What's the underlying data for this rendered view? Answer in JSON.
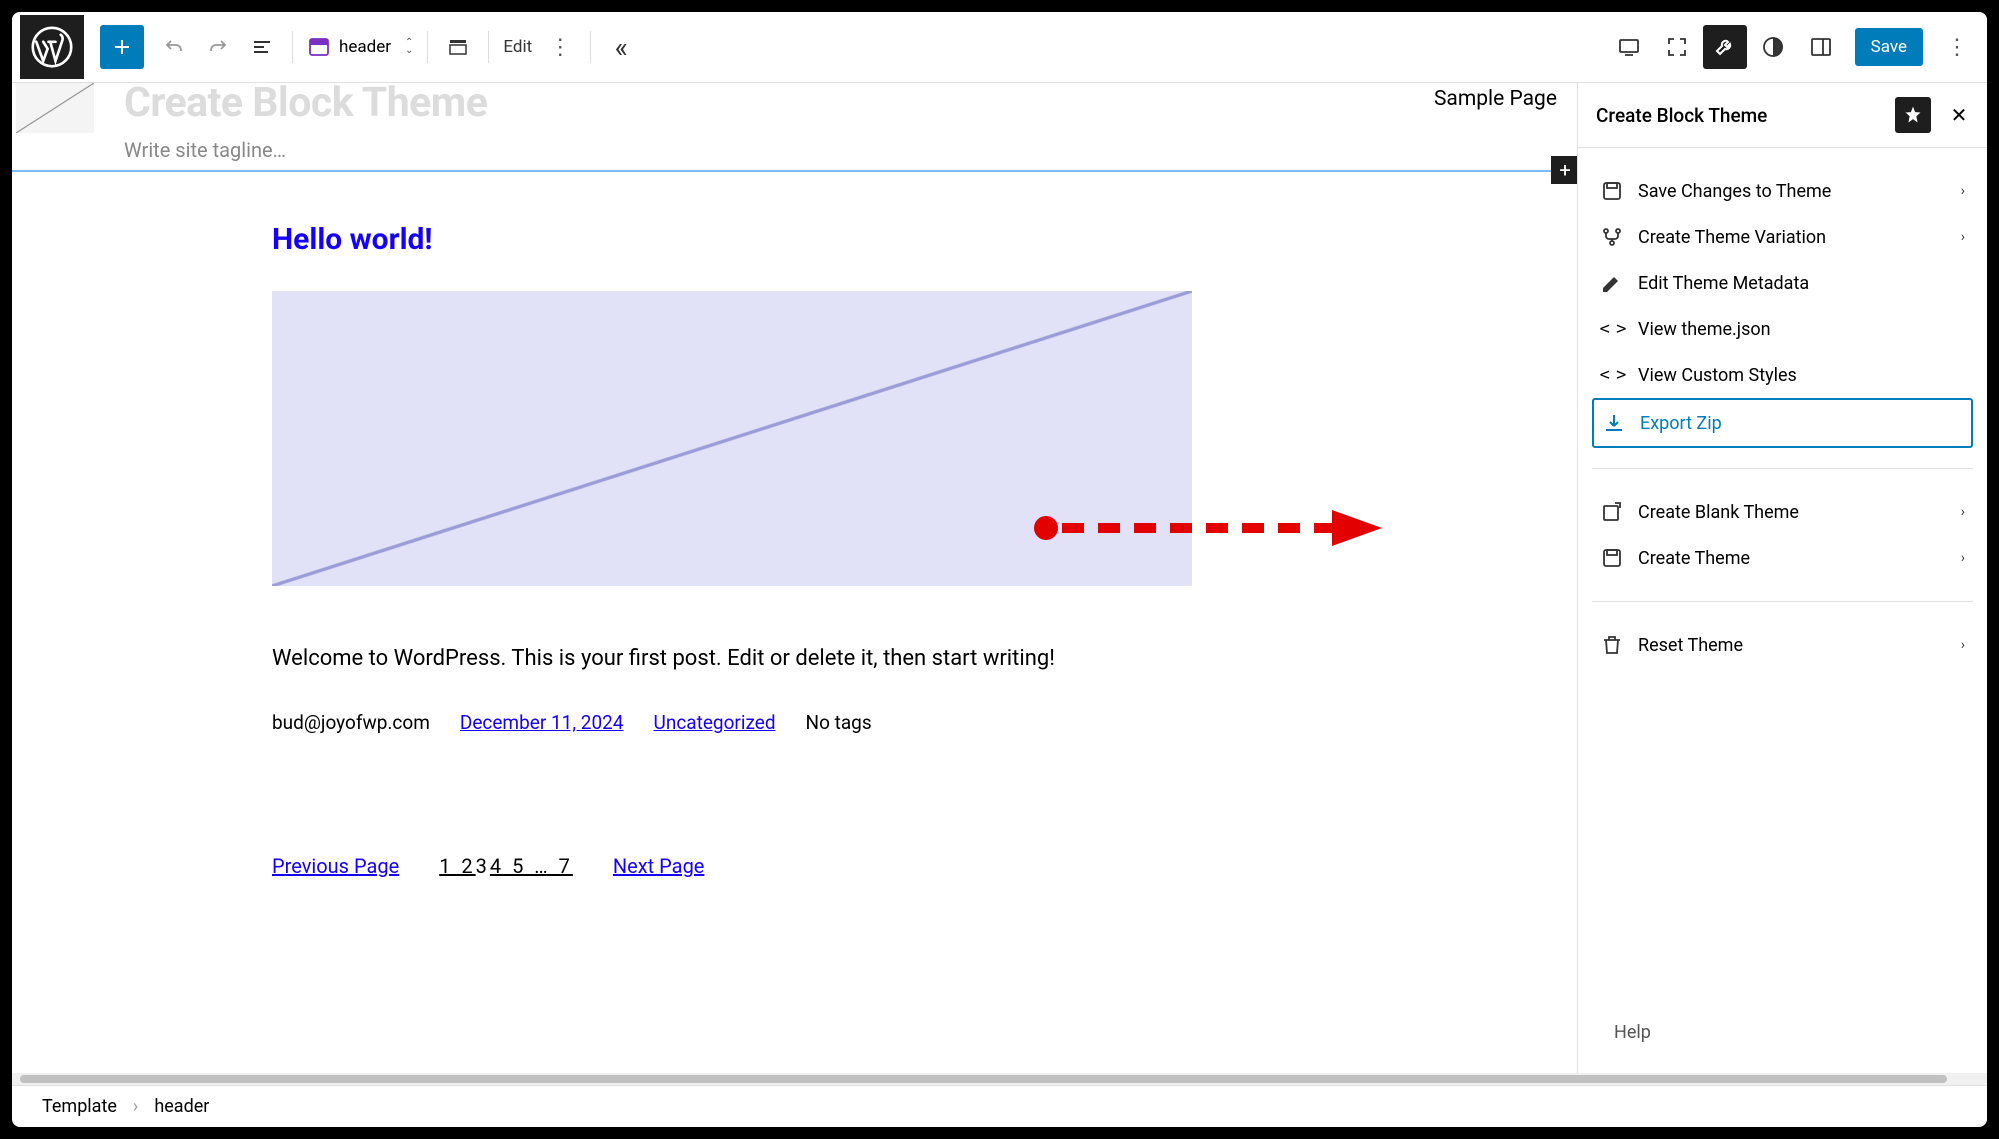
{
  "toolbar": {
    "template_label": "header",
    "edit_label": "Edit",
    "save_label": "Save"
  },
  "canvas": {
    "site_title": "Create Block Theme",
    "tagline_placeholder": "Write site tagline…",
    "nav_link": "Sample Page",
    "post": {
      "title": "Hello world!",
      "body": "Welcome to WordPress. This is your first post. Edit or delete it, then start writing!",
      "author": "bud@joyofwp.com",
      "date": "December 11, 2024",
      "category": "Uncategorized",
      "tags": "No tags"
    },
    "pagination": {
      "prev": "Previous Page",
      "next": "Next Page",
      "pages_prefix": "1 2",
      "pages_current": "3",
      "pages_suffix": "4 5 … 7"
    }
  },
  "sidebar": {
    "title": "Create Block Theme",
    "items": [
      {
        "label": "Save Changes to Theme",
        "icon": "save-theme",
        "chevron": true
      },
      {
        "label": "Create Theme Variation",
        "icon": "variation",
        "chevron": true
      },
      {
        "label": "Edit Theme Metadata",
        "icon": "pencil",
        "chevron": false
      },
      {
        "label": "View theme.json",
        "icon": "code",
        "chevron": false
      },
      {
        "label": "View Custom Styles",
        "icon": "code",
        "chevron": false
      },
      {
        "label": "Export Zip",
        "icon": "download",
        "chevron": false,
        "highlighted": true
      }
    ],
    "items2": [
      {
        "label": "Create Blank Theme",
        "icon": "blank",
        "chevron": true
      },
      {
        "label": "Create Theme",
        "icon": "save-theme",
        "chevron": true
      }
    ],
    "items3": [
      {
        "label": "Reset Theme",
        "icon": "trash",
        "chevron": true
      }
    ],
    "help_label": "Help"
  },
  "breadcrumb": {
    "root": "Template",
    "current": "header"
  }
}
